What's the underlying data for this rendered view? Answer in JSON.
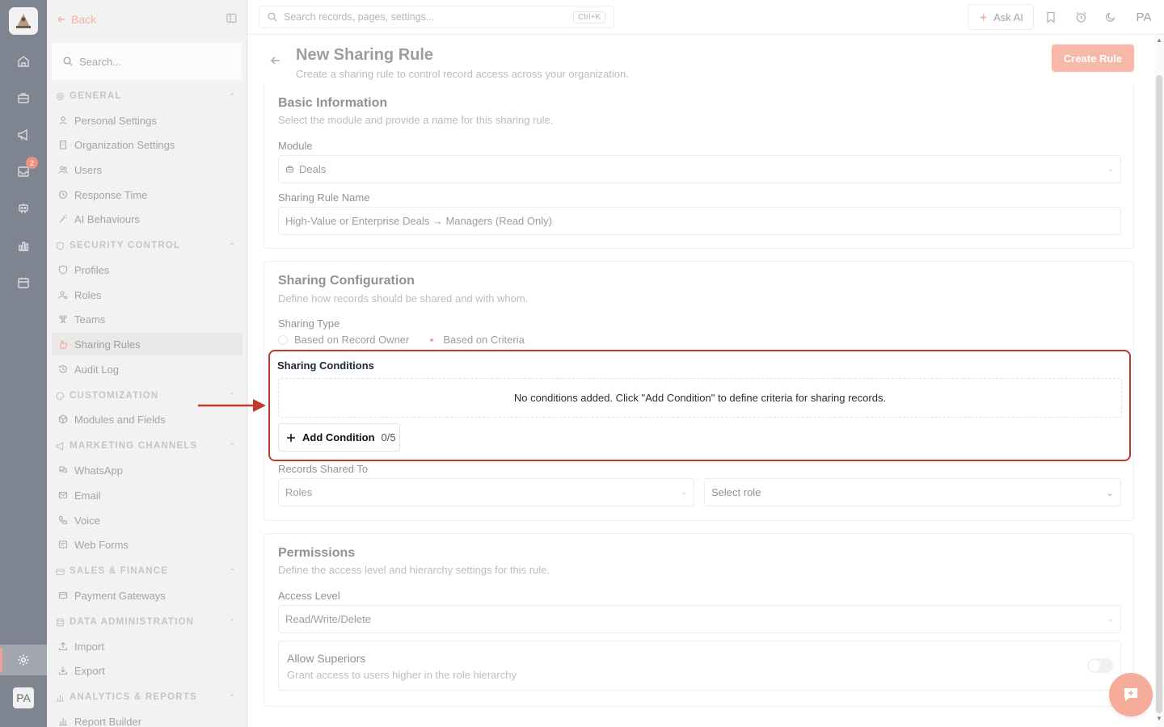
{
  "sidebar": {
    "back_label": "Back",
    "search_placeholder": "Search...",
    "groups": [
      {
        "label": "GENERAL",
        "items": [
          "Personal Settings",
          "Organization Settings",
          "Users",
          "Response Time",
          "AI Behaviours"
        ]
      },
      {
        "label": "SECURITY CONTROL",
        "items": [
          "Profiles",
          "Roles",
          "Teams",
          "Sharing Rules",
          "Audit Log"
        ]
      },
      {
        "label": "CUSTOMIZATION",
        "items": [
          "Modules and Fields"
        ]
      },
      {
        "label": "MARKETING CHANNELS",
        "items": [
          "WhatsApp",
          "Email",
          "Voice",
          "Web Forms"
        ]
      },
      {
        "label": "SALES & FINANCE",
        "items": [
          "Payment Gateways"
        ]
      },
      {
        "label": "DATA ADMINISTRATION",
        "items": [
          "Import",
          "Export"
        ]
      },
      {
        "label": "ANALYTICS & REPORTS",
        "items": [
          "Report Builder"
        ]
      }
    ],
    "active_item": "Sharing Rules"
  },
  "rail": {
    "inbox_badge": "2",
    "avatar_initials": "PA"
  },
  "topbar": {
    "search_placeholder": "Search records, pages, settings...",
    "search_shortcut": "Ctrl+K",
    "ask_ai_label": "Ask AI",
    "user_initials": "PA"
  },
  "page": {
    "title": "New Sharing Rule",
    "subtitle": "Create a sharing rule to control record access across your organization.",
    "create_button": "Create Rule"
  },
  "basic_info": {
    "title": "Basic Information",
    "subtitle": "Select the module and provide a name for this sharing rule.",
    "module_label": "Module",
    "module_value": "Deals",
    "name_label": "Sharing Rule Name",
    "name_value": "High-Value or Enterprise Deals → Managers (Read Only)"
  },
  "sharing_config": {
    "title": "Sharing Configuration",
    "subtitle": "Define how records should be shared and with whom.",
    "type_label": "Sharing Type",
    "type_options": [
      "Based on Record Owner",
      "Based on Criteria"
    ],
    "type_selected": "Based on Criteria",
    "conditions_title": "Sharing Conditions",
    "conditions_empty": "No conditions added. Click \"Add Condition\" to define criteria for sharing records.",
    "add_condition_label": "Add Condition",
    "add_condition_count": "0/5",
    "shared_to_label": "Records Shared To",
    "shared_to_type": "Roles",
    "shared_to_role_placeholder": "Select role"
  },
  "permissions": {
    "title": "Permissions",
    "subtitle": "Define the access level and hierarchy settings for this rule.",
    "access_label": "Access Level",
    "access_value": "Read/Write/Delete",
    "superiors_title": "Allow Superiors",
    "superiors_sub": "Grant access to users higher in the role hierarchy",
    "superiors_enabled": false
  },
  "colors": {
    "accent": "#f7b7a9",
    "highlight_border": "#c0392b",
    "rail": "#7e8590"
  }
}
